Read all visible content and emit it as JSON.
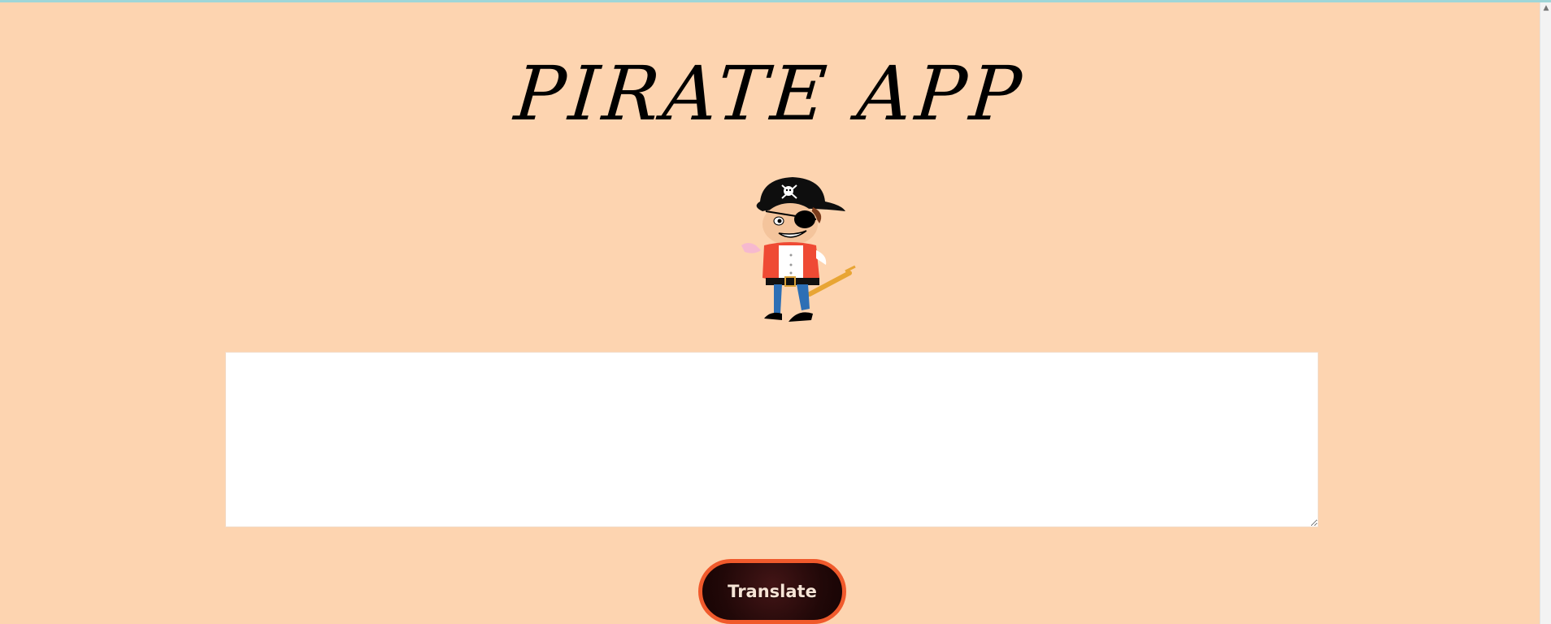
{
  "page": {
    "title": "PIRATE APP",
    "background_color": "#fdd4b0"
  },
  "mascot": {
    "icon": "pirate-mascot-icon"
  },
  "input": {
    "value": "",
    "placeholder": ""
  },
  "actions": {
    "translate_label": "Translate"
  },
  "colors": {
    "button_border": "#f05a2c",
    "button_fill": "#2a0a0a",
    "title": "#000000"
  }
}
